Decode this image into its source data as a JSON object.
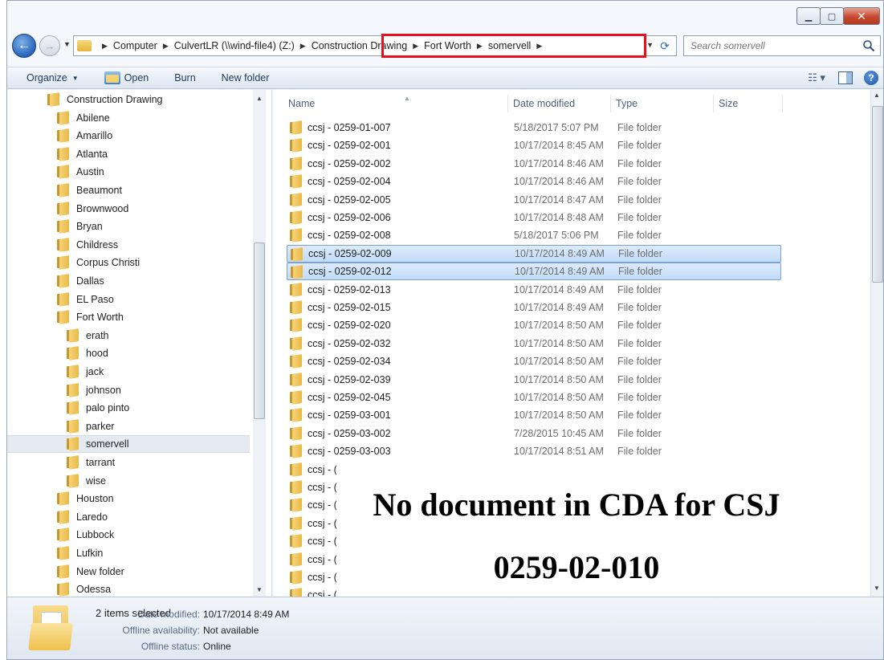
{
  "address": {
    "crumbs": [
      "Computer",
      "CulvertLR (\\\\wind-file4) (Z:)",
      "Construction Drawing",
      "Fort Worth",
      "somervell"
    ]
  },
  "search": {
    "placeholder": "Search somervell"
  },
  "toolbar": {
    "organize": "Organize",
    "open": "Open",
    "burn": "Burn",
    "new_folder": "New folder"
  },
  "sidebar": {
    "items": [
      {
        "label": "Construction Drawing",
        "level": 0
      },
      {
        "label": "Abilene",
        "level": 1
      },
      {
        "label": "Amarillo",
        "level": 1
      },
      {
        "label": "Atlanta",
        "level": 1
      },
      {
        "label": "Austin",
        "level": 1
      },
      {
        "label": "Beaumont",
        "level": 1
      },
      {
        "label": "Brownwood",
        "level": 1
      },
      {
        "label": "Bryan",
        "level": 1
      },
      {
        "label": "Childress",
        "level": 1
      },
      {
        "label": "Corpus Christi",
        "level": 1
      },
      {
        "label": "Dallas",
        "level": 1
      },
      {
        "label": "EL Paso",
        "level": 1
      },
      {
        "label": "Fort Worth",
        "level": 1
      },
      {
        "label": "erath",
        "level": 2
      },
      {
        "label": "hood",
        "level": 2
      },
      {
        "label": "jack",
        "level": 2
      },
      {
        "label": "johnson",
        "level": 2
      },
      {
        "label": "palo pinto",
        "level": 2
      },
      {
        "label": "parker",
        "level": 2
      },
      {
        "label": "somervell",
        "level": 2,
        "selected": true
      },
      {
        "label": "tarrant",
        "level": 2
      },
      {
        "label": "wise",
        "level": 2
      },
      {
        "label": "Houston",
        "level": 1
      },
      {
        "label": "Laredo",
        "level": 1
      },
      {
        "label": "Lubbock",
        "level": 1
      },
      {
        "label": "Lufkin",
        "level": 1
      },
      {
        "label": "New folder",
        "level": 1
      },
      {
        "label": "Odessa",
        "level": 1
      }
    ]
  },
  "file_list": {
    "columns": [
      "Name",
      "Date modified",
      "Type",
      "Size"
    ],
    "rows": [
      {
        "name": "ccsj - 0259-01-007",
        "date": "5/18/2017 5:07 PM",
        "type": "File folder"
      },
      {
        "name": "ccsj - 0259-02-001",
        "date": "10/17/2014 8:45 AM",
        "type": "File folder"
      },
      {
        "name": "ccsj - 0259-02-002",
        "date": "10/17/2014 8:46 AM",
        "type": "File folder"
      },
      {
        "name": "ccsj - 0259-02-004",
        "date": "10/17/2014 8:46 AM",
        "type": "File folder"
      },
      {
        "name": "ccsj - 0259-02-005",
        "date": "10/17/2014 8:47 AM",
        "type": "File folder"
      },
      {
        "name": "ccsj - 0259-02-006",
        "date": "10/17/2014 8:48 AM",
        "type": "File folder"
      },
      {
        "name": "ccsj - 0259-02-008",
        "date": "5/18/2017 5:06 PM",
        "type": "File folder"
      },
      {
        "name": "ccsj - 0259-02-009",
        "date": "10/17/2014 8:49 AM",
        "type": "File folder",
        "selected": true
      },
      {
        "name": "ccsj - 0259-02-012",
        "date": "10/17/2014 8:49 AM",
        "type": "File folder",
        "selected": true
      },
      {
        "name": "ccsj - 0259-02-013",
        "date": "10/17/2014 8:49 AM",
        "type": "File folder"
      },
      {
        "name": "ccsj - 0259-02-015",
        "date": "10/17/2014 8:49 AM",
        "type": "File folder"
      },
      {
        "name": "ccsj - 0259-02-020",
        "date": "10/17/2014 8:50 AM",
        "type": "File folder"
      },
      {
        "name": "ccsj - 0259-02-032",
        "date": "10/17/2014 8:50 AM",
        "type": "File folder"
      },
      {
        "name": "ccsj - 0259-02-034",
        "date": "10/17/2014 8:50 AM",
        "type": "File folder"
      },
      {
        "name": "ccsj - 0259-02-039",
        "date": "10/17/2014 8:50 AM",
        "type": "File folder"
      },
      {
        "name": "ccsj - 0259-02-045",
        "date": "10/17/2014 8:50 AM",
        "type": "File folder"
      },
      {
        "name": "ccsj - 0259-03-001",
        "date": "10/17/2014 8:50 AM",
        "type": "File folder"
      },
      {
        "name": "ccsj - 0259-03-002",
        "date": "7/28/2015 10:45 AM",
        "type": "File folder"
      },
      {
        "name": "ccsj - 0259-03-003",
        "date": "10/17/2014 8:51 AM",
        "type": "File folder"
      },
      {
        "name": "ccsj - (",
        "date": "",
        "type": ""
      },
      {
        "name": "ccsj - (",
        "date": "",
        "type": ""
      },
      {
        "name": "ccsj - (",
        "date": "",
        "type": ""
      },
      {
        "name": "ccsj - (",
        "date": "",
        "type": ""
      },
      {
        "name": "ccsj - (",
        "date": "",
        "type": ""
      },
      {
        "name": "ccsj - (",
        "date": "",
        "type": ""
      },
      {
        "name": "ccsj - (",
        "date": "",
        "type": ""
      },
      {
        "name": "ccsj - (",
        "date": "",
        "type": ""
      }
    ]
  },
  "overlay": {
    "line1": "No document in CDA for CSJ",
    "line2": "0259-02-010"
  },
  "details": {
    "selection": "2 items selected",
    "date_modified_label": "Date modified:",
    "date_modified": "10/17/2014 8:49 AM",
    "offline_availability_label": "Offline availability:",
    "offline_availability": "Not available",
    "offline_status_label": "Offline status:",
    "offline_status": "Online"
  },
  "colors": {
    "highlight_box": "#e8101a",
    "selection_bg": "#cde3fa",
    "toolbar_text": "#1e395b"
  }
}
